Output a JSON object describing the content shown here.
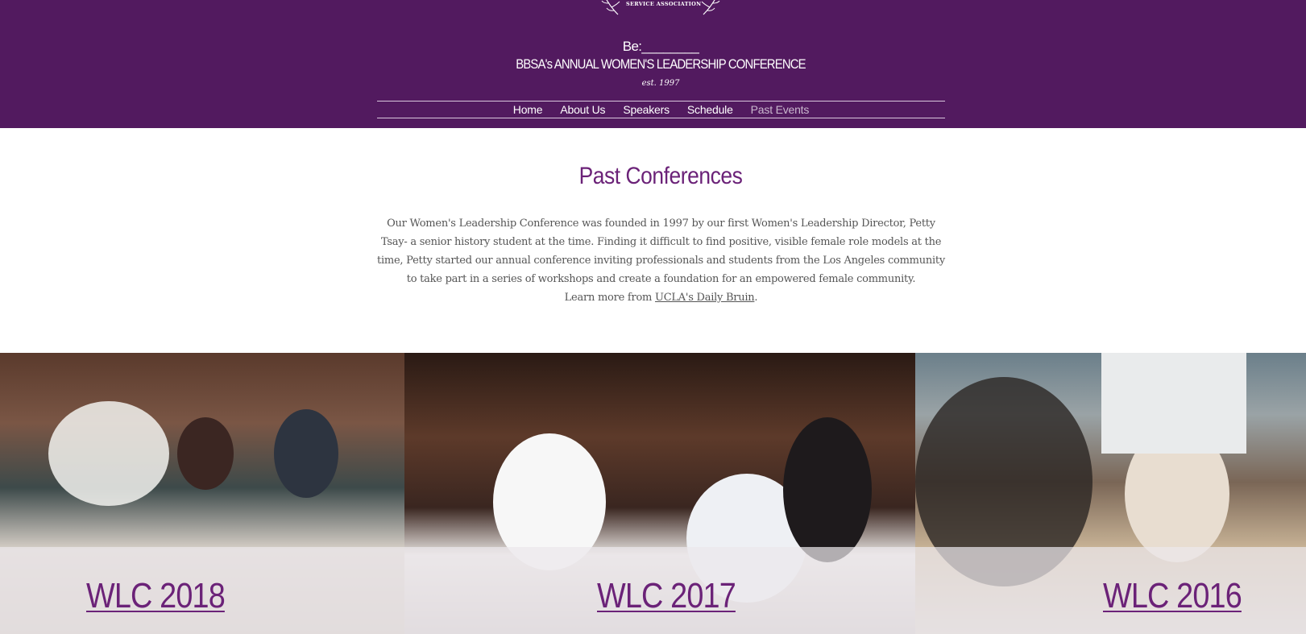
{
  "header": {
    "logo_text": "SERVICE ASSOCIATION",
    "tagline": "Be:________",
    "conference_title": "BBSA's ANNUAL WOMEN'S LEADERSHIP CONFERENCE",
    "established": "est. 1997"
  },
  "nav": {
    "items": [
      {
        "label": "Home",
        "active": false
      },
      {
        "label": "About Us",
        "active": false
      },
      {
        "label": "Speakers",
        "active": false
      },
      {
        "label": "Schedule",
        "active": false
      },
      {
        "label": "Past Events",
        "active": true
      }
    ]
  },
  "main": {
    "title": "Past Conferences",
    "intro": "Our Women's Leadership Conference was founded in 1997 by our first Women's Leadership Director, Petty Tsay- a senior history student at the time. Finding it difficult to find positive, visible female role models at the time, Petty started our annual conference inviting professionals and students from the Los Angeles community to take part in a series of workshops and create a foundation for an empowered female community.",
    "learn_more_prefix": "Learn more from ",
    "learn_more_link": "UCLA's Daily Bruin",
    "learn_more_suffix": "."
  },
  "gallery": {
    "items": [
      {
        "label": "WLC 2018"
      },
      {
        "label": "WLC 2017"
      },
      {
        "label": "WLC 2016"
      }
    ]
  },
  "colors": {
    "header_bg": "#521a5f",
    "accent": "#6b2278",
    "body_text": "#555555"
  }
}
